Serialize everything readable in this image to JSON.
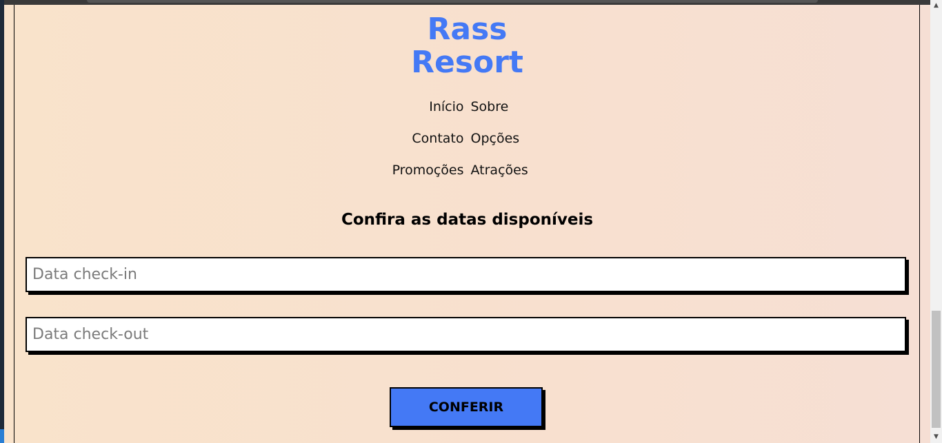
{
  "brand": {
    "line1": "Rass",
    "line2": "Resort",
    "color": "#4479f5"
  },
  "nav": {
    "rows": [
      {
        "left": "Início",
        "right": "Sobre"
      },
      {
        "left": "Contato",
        "right": "Opções"
      },
      {
        "left": "Promoções",
        "right": "Atrações"
      }
    ]
  },
  "booking": {
    "heading": "Confira as datas disponíveis",
    "checkin_placeholder": "Data check-in",
    "checkin_value": "",
    "checkout_placeholder": "Data check-out",
    "checkout_value": "",
    "submit_label": "CONFERIR",
    "button_color": "#4479f5"
  },
  "colors": {
    "background": "#f8e0cf",
    "text": "#000000"
  },
  "icons": {
    "scroll_up": "chevron-up-icon",
    "scroll_down": "chevron-down-icon"
  }
}
